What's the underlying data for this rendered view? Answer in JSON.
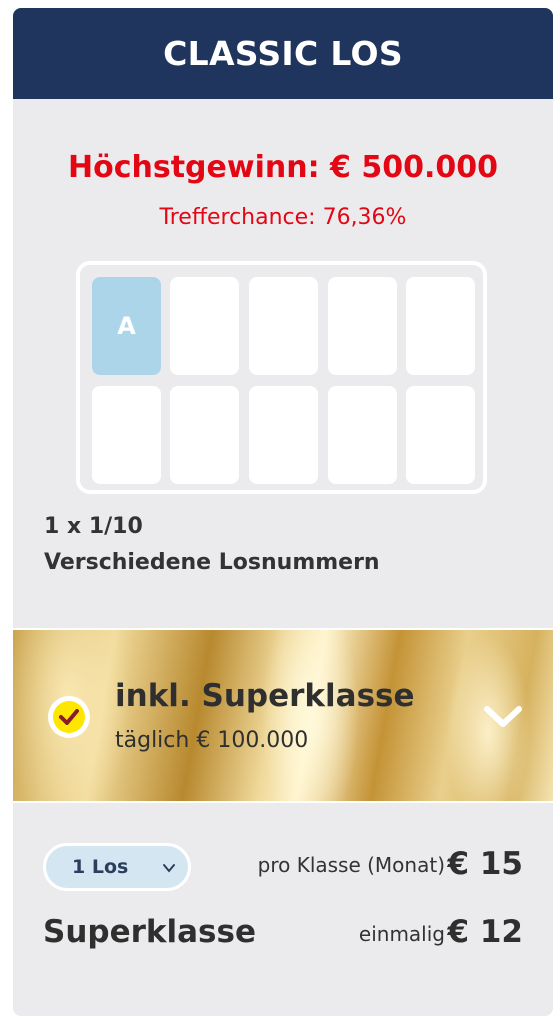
{
  "header": {
    "title": "CLASSIC LOS"
  },
  "prize": {
    "max_win": "Höchstgewinn: € 500.000",
    "chance": "Trefferchance: 76,36%"
  },
  "ticket_grid": {
    "selected_cell_label": "A"
  },
  "ticket_info": {
    "line1": "1 x 1/10",
    "line2": "Verschiedene Losnummern"
  },
  "superklasse_option": {
    "title": "inkl. Superklasse",
    "subtitle": "täglich € 100.000",
    "checked": true
  },
  "pricing": {
    "quantity_select": {
      "value": "1 Los"
    },
    "per_class_label": "pro Klasse (Monat)",
    "per_class_price": "€ 15",
    "superklasse_label": "Superklasse",
    "once_label": "einmalig",
    "once_price": "€ 12"
  },
  "colors": {
    "header_bg": "#1f355d",
    "accent_red": "#e30613",
    "card_bg": "#ebebee",
    "selected_cell": "#acd5ea",
    "check_yellow": "#ffe600",
    "check_mark": "#8b1a2b"
  },
  "icons": {
    "check": "checkmark-icon",
    "expand": "chevron-down-icon",
    "select_caret": "chevron-down-icon"
  }
}
